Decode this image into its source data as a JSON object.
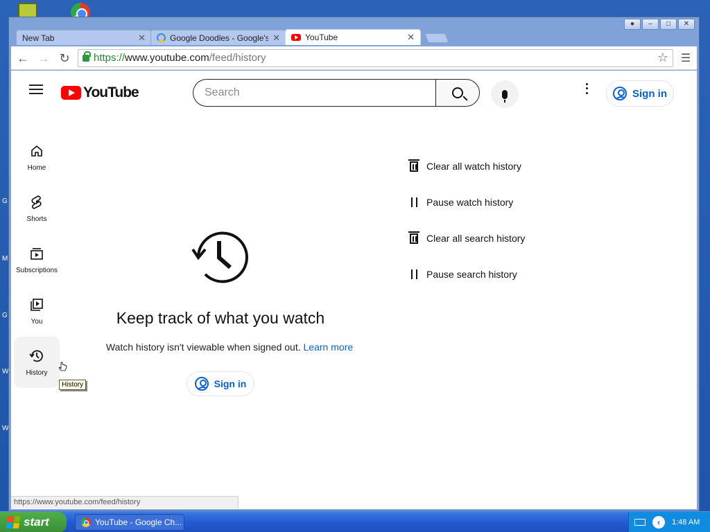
{
  "browser": {
    "tabs": [
      {
        "label": "New Tab",
        "favicon": "none",
        "active": false
      },
      {
        "label": "Google Doodles - Google's Se",
        "favicon": "google-icon",
        "active": false
      },
      {
        "label": "YouTube",
        "favicon": "youtube-icon",
        "active": true
      }
    ],
    "url": {
      "scheme": "https://",
      "host": "www.youtube.com",
      "path": "/feed/history"
    },
    "status_url": "https://www.youtube.com/feed/history"
  },
  "youtube": {
    "logo_text": "YouTube",
    "search_placeholder": "Search",
    "signin_label": "Sign in",
    "sidebar": [
      {
        "label": "Home",
        "icon": "home-icon"
      },
      {
        "label": "Shorts",
        "icon": "shorts-icon"
      },
      {
        "label": "Subscriptions",
        "icon": "subscriptions-icon"
      },
      {
        "label": "You",
        "icon": "you-icon"
      },
      {
        "label": "History",
        "icon": "history-icon"
      }
    ],
    "tooltip": "History",
    "empty_state": {
      "title": "Keep track of what you watch",
      "subtitle": "Watch history isn't viewable when signed out.",
      "link": "Learn more",
      "signin_label": "Sign in"
    },
    "actions": [
      {
        "label": "Clear all watch history",
        "icon": "trash-icon"
      },
      {
        "label": "Pause watch history",
        "icon": "pause-icon"
      },
      {
        "label": "Clear all search history",
        "icon": "trash-icon"
      },
      {
        "label": "Pause search history",
        "icon": "pause-icon"
      }
    ]
  },
  "taskbar": {
    "start_label": "start",
    "task_label": "YouTube - Google Ch...",
    "clock": "1:48 AM"
  },
  "desktop": {
    "edge_letters": [
      "G",
      "M",
      "G",
      "W",
      "W"
    ]
  },
  "colors": {
    "youtube_red": "#ff0000",
    "link_blue": "#065fd4",
    "xp_taskbar": "#245bd0",
    "xp_start": "#3a8f36"
  }
}
